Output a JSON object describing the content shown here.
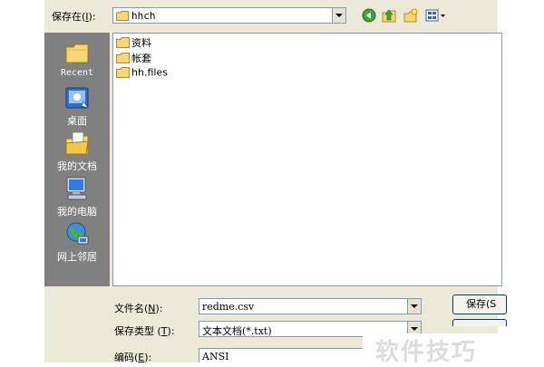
{
  "save_in": {
    "label": "保存在",
    "accel": "I",
    "value": "hhch"
  },
  "toolbar": {
    "icons": [
      "back-icon",
      "up-folder-icon",
      "new-folder-icon",
      "view-menu-icon"
    ]
  },
  "places": [
    {
      "label": "Recent",
      "icon": "recent-icon"
    },
    {
      "label": "桌面",
      "icon": "desktop-icon"
    },
    {
      "label": "我的文档",
      "icon": "my-documents-icon"
    },
    {
      "label": "我的电脑",
      "icon": "my-computer-icon"
    },
    {
      "label": "网上邻居",
      "icon": "network-places-icon"
    }
  ],
  "files": [
    {
      "name": "资料"
    },
    {
      "name": "帐套"
    },
    {
      "name": "hh.files"
    }
  ],
  "filename": {
    "label": "文件名",
    "accel": "N",
    "value": "redme.csv"
  },
  "filetype": {
    "label": "保存类型",
    "accel": "T",
    "value": "文本文档(*.txt)"
  },
  "encoding": {
    "label": "编码",
    "accel": "E",
    "value": "ANSI"
  },
  "buttons": {
    "save": "保存(S"
  },
  "watermark": "软件技巧"
}
